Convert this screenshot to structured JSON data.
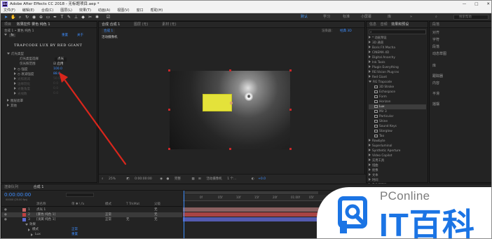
{
  "window": {
    "title": "Adobe After Effects CC 2018 - 无标题项目.aep *",
    "app_icon": "Ae",
    "controls": [
      "—",
      "□",
      "✕"
    ]
  },
  "menu": [
    "文件(F)",
    "编辑(E)",
    "合成(C)",
    "图层(L)",
    "效果(T)",
    "动画(A)",
    "视图(V)",
    "窗口",
    "帮助(H)"
  ],
  "workspaces": [
    "默认",
    "学习",
    "标准",
    "小屏幕",
    "库"
  ],
  "search_help": {
    "placeholder": "搜索帮助"
  },
  "effects_panel": {
    "tabs": [
      "项目",
      "效果控件 雾色 纯色 1"
    ],
    "header": "合成 1 • 雾色 纯色 1",
    "fx_label": "fx",
    "fx_buttons": [
      "重置",
      "关于"
    ],
    "banner": "TRAPCODE LUX BY RED GIANT",
    "props": [
      {
        "label": "灯光类型",
        "value": ""
      },
      {
        "label": "灯光类型选择",
        "value": "点光"
      },
      {
        "label": "仅光照范围",
        "value": "启用"
      },
      {
        "label": "强度",
        "value": "100.0"
      },
      {
        "label": "衰减强度",
        "value": "88.0"
      },
      {
        "label": "光照衰减",
        "value": "50.0"
      },
      {
        "label": "边缘羽化",
        "value": "0.0"
      },
      {
        "label": "光锥角度",
        "value": "0.0"
      },
      {
        "label": "光线数",
        "value": "0.0"
      }
    ],
    "groups": [
      "图层遮罩",
      "其他"
    ]
  },
  "composition": {
    "tabs": [
      "合成 合成 1",
      "图层 (无)",
      "素材 (无)"
    ],
    "active_tab": "合成 1",
    "viewer_label": "活动摄像机",
    "renderer_label": "渲染器：",
    "renderer_value": "经典 3D",
    "footer": {
      "zoom": "25%",
      "time": "0:00:00:00",
      "quality": "完整",
      "view": "活动摄像机",
      "views_count": "1 个...",
      "offset": "+0.0"
    }
  },
  "effects_presets": {
    "tabs": [
      "信息",
      "音频",
      "效果和预设"
    ],
    "search_value": "",
    "items": [
      {
        "type": "folder",
        "label": "* 动画预设"
      },
      {
        "type": "folder",
        "label": "3D 通道"
      },
      {
        "type": "folder",
        "label": "Boris FX Mocha"
      },
      {
        "type": "folder",
        "label": "CINEMA 4D"
      },
      {
        "type": "folder",
        "label": "Digital Anarchy"
      },
      {
        "type": "folder",
        "label": "Ink Tools"
      },
      {
        "type": "folder",
        "label": "Plugin Everything"
      },
      {
        "type": "folder",
        "label": "RE:Vision Plug-ins"
      },
      {
        "type": "folder",
        "label": "Red Giant"
      },
      {
        "type": "open",
        "label": "RG Trapcode"
      },
      {
        "type": "fx",
        "label": "3D Stroke"
      },
      {
        "type": "fx",
        "label": "Echospace"
      },
      {
        "type": "fx",
        "label": "Form"
      },
      {
        "type": "fx",
        "label": "Horizon"
      },
      {
        "type": "fx",
        "label": "Lux",
        "selected": true
      },
      {
        "type": "fx",
        "label": "Mir 3"
      },
      {
        "type": "fx",
        "label": "Particular"
      },
      {
        "type": "fx",
        "label": "Shine"
      },
      {
        "type": "fx",
        "label": "Sound Keys"
      },
      {
        "type": "fx",
        "label": "Starglow"
      },
      {
        "type": "fx",
        "label": "Tao"
      },
      {
        "type": "folder",
        "label": "Rowbyte"
      },
      {
        "type": "folder",
        "label": "Superluminal"
      },
      {
        "type": "folder",
        "label": "Synthetic Aperture"
      },
      {
        "type": "folder",
        "label": "Video Copilot"
      },
      {
        "type": "folder",
        "label": "实用工具"
      },
      {
        "type": "folder",
        "label": "扭曲"
      },
      {
        "type": "folder",
        "label": "抠像"
      },
      {
        "type": "folder",
        "label": "文本"
      },
      {
        "type": "folder",
        "label": "时间"
      },
      {
        "type": "folder",
        "label": "杂色和颗粒"
      },
      {
        "type": "folder",
        "label": "模拟"
      }
    ]
  },
  "right_panel": {
    "title": "段落",
    "items": [
      "对齐",
      "字符",
      "段落",
      "动态草图",
      "库",
      "跟踪器",
      "内容",
      "平滑",
      "摇摆"
    ]
  },
  "timeline": {
    "tabs": [
      "渲染队列",
      "合成 1"
    ],
    "time": "0:00:00:00",
    "fps": "00000 (25.00 fps)",
    "columns": [
      "源名称",
      "单 ✱ \\ fx",
      "模式",
      "T TrkMat",
      "父级"
    ],
    "layers": [
      {
        "num": "1",
        "color": "#c76464",
        "name": "点光 1",
        "mode": "",
        "trk": "",
        "parent": "无"
      },
      {
        "num": "2",
        "color": "#c04040",
        "name": "[雾色 纯色 1]",
        "mode": "正常",
        "trk": "",
        "parent": "无",
        "selected": true
      },
      {
        "num": "3",
        "color": "#5d6bd2",
        "name": "[浅黄 纯色 1]",
        "mode": "正常",
        "trk": "无",
        "parent": "无"
      }
    ],
    "sub_rows": [
      {
        "label": "效果",
        "value": ""
      },
      {
        "label": "模式",
        "value": "正常"
      },
      {
        "label": "Lux",
        "value": "重置"
      }
    ],
    "ruler": [
      "0f",
      "05f",
      "10f",
      "15f",
      "20f",
      "01:00f",
      "05f",
      "10f"
    ]
  },
  "watermark": {
    "brand": "PConline",
    "name": "IT百科",
    "blue": "#1b74e4"
  },
  "colors": {
    "accent": "#3e8eff",
    "arrow": "#d9261c",
    "solid": "#e4e23a"
  }
}
